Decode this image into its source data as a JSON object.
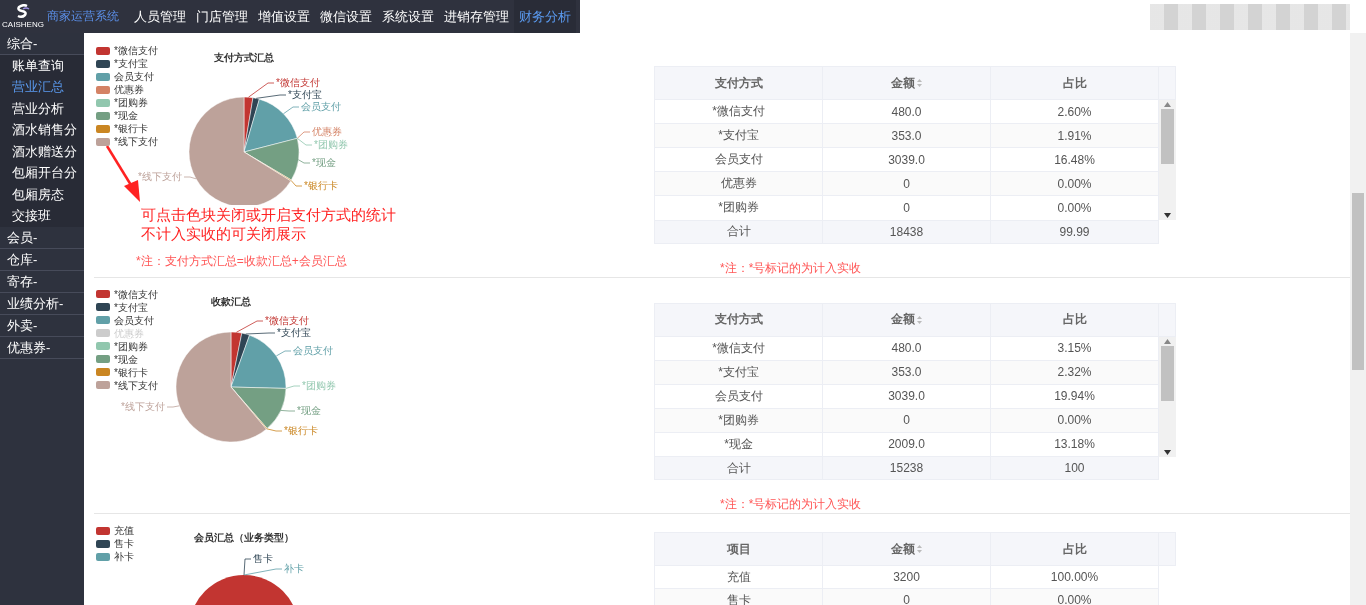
{
  "topbar": {
    "logo_text": "CAISHENG",
    "app_name": "商家运营系统",
    "nav": [
      {
        "label": "人员管理",
        "selected": false
      },
      {
        "label": "门店管理",
        "selected": false
      },
      {
        "label": "增值设置",
        "selected": false
      },
      {
        "label": "微信设置",
        "selected": false
      },
      {
        "label": "系统设置",
        "selected": false
      },
      {
        "label": "进销存管理",
        "selected": false
      },
      {
        "label": "财务分析",
        "selected": true
      }
    ]
  },
  "sidebar": {
    "groups": [
      {
        "label": "综合-",
        "children": [
          {
            "label": "账单查询",
            "selected": false
          },
          {
            "label": "营业汇总",
            "selected": true
          },
          {
            "label": "营业分析",
            "selected": false
          },
          {
            "label": "酒水销售分",
            "selected": false
          },
          {
            "label": "酒水赠送分",
            "selected": false
          },
          {
            "label": "包厢开台分",
            "selected": false
          },
          {
            "label": "包厢房态",
            "selected": false
          },
          {
            "label": "交接班",
            "selected": false
          }
        ]
      },
      {
        "label": "会员-"
      },
      {
        "label": "仓库-"
      },
      {
        "label": "寄存-"
      },
      {
        "label": "业绩分析-"
      },
      {
        "label": "外卖-"
      },
      {
        "label": "优惠券-"
      }
    ]
  },
  "sections": [
    {
      "chart": {
        "title": "支付方式汇总",
        "legend": [
          {
            "label": "*微信支付",
            "color": "#c23531",
            "disabled": false,
            "slice_label": "*微信支付"
          },
          {
            "label": "*支付宝",
            "color": "#2f4554",
            "disabled": false,
            "slice_label": "*支付宝"
          },
          {
            "label": "会员支付",
            "color": "#61a0a8",
            "disabled": false,
            "slice_label": "会员支付"
          },
          {
            "label": "优惠券",
            "color": "#d48265",
            "disabled": false,
            "slice_label": "优惠券"
          },
          {
            "label": "*团购券",
            "color": "#91c7ae",
            "disabled": false,
            "slice_label": "*团购券"
          },
          {
            "label": "*现金",
            "color": "#749f83",
            "disabled": false,
            "slice_label": "*现金"
          },
          {
            "label": "*银行卡",
            "color": "#ca8622",
            "disabled": false,
            "slice_label": "*银行卡"
          },
          {
            "label": "*线下支付",
            "color": "#bda29a",
            "disabled": false,
            "slice_label": "*线下支付"
          }
        ]
      },
      "annotation": [
        "可点击色块关闭或开启支付方式的统计",
        "不计入实收的可关闭展示"
      ],
      "note_left": "*注：支付方式汇总=收款汇总+会员汇总",
      "table": {
        "scrollable": true,
        "columns": [
          {
            "label": "支付方式",
            "sortable": false
          },
          {
            "label": "金额",
            "sortable": true
          },
          {
            "label": "占比",
            "sortable": false
          }
        ],
        "rows": [
          [
            "*微信支付",
            "480.0",
            "2.60%"
          ],
          [
            "*支付宝",
            "353.0",
            "1.91%"
          ],
          [
            "会员支付",
            "3039.0",
            "16.48%"
          ],
          [
            "优惠券",
            "0",
            "0.00%"
          ],
          [
            "*团购券",
            "0",
            "0.00%"
          ]
        ],
        "total": [
          "合计",
          "18438",
          "99.99"
        ]
      },
      "note_right": "*注：*号标记的为计入实收"
    },
    {
      "chart": {
        "title": "收款汇总",
        "legend": [
          {
            "label": "*微信支付",
            "color": "#c23531",
            "disabled": false,
            "slice_label": "*微信支付"
          },
          {
            "label": "*支付宝",
            "color": "#2f4554",
            "disabled": false,
            "slice_label": "*支付宝"
          },
          {
            "label": "会员支付",
            "color": "#61a0a8",
            "disabled": false,
            "slice_label": "会员支付"
          },
          {
            "label": "优惠券",
            "disabled": true
          },
          {
            "label": "*团购券",
            "color": "#91c7ae",
            "disabled": false,
            "slice_label": "*团购券"
          },
          {
            "label": "*现金",
            "color": "#749f83",
            "disabled": false,
            "slice_label": "*现金"
          },
          {
            "label": "*银行卡",
            "color": "#ca8622",
            "disabled": false,
            "slice_label": "*银行卡"
          },
          {
            "label": "*线下支付",
            "color": "#bda29a",
            "disabled": false,
            "slice_label": "*线下支付"
          }
        ]
      },
      "table": {
        "scrollable": true,
        "columns": [
          {
            "label": "支付方式",
            "sortable": false
          },
          {
            "label": "金额",
            "sortable": true
          },
          {
            "label": "占比",
            "sortable": false
          }
        ],
        "rows": [
          [
            "*微信支付",
            "480.0",
            "3.15%"
          ],
          [
            "*支付宝",
            "353.0",
            "2.32%"
          ],
          [
            "会员支付",
            "3039.0",
            "19.94%"
          ],
          [
            "*团购券",
            "0",
            "0.00%"
          ],
          [
            "*现金",
            "2009.0",
            "13.18%"
          ]
        ],
        "total": [
          "合计",
          "15238",
          "100"
        ]
      },
      "note_right": "*注：*号标记的为计入实收"
    },
    {
      "chart": {
        "title": "会员汇总（业务类型）",
        "legend": [
          {
            "label": "充值",
            "color": "#c23531",
            "disabled": false
          },
          {
            "label": "售卡",
            "color": "#2f4554",
            "disabled": false,
            "slice_label": "售卡"
          },
          {
            "label": "补卡",
            "color": "#61a0a8",
            "disabled": false,
            "slice_label": "补卡"
          }
        ]
      },
      "table": {
        "scrollable": false,
        "columns": [
          {
            "label": "项目",
            "sortable": false
          },
          {
            "label": "金额",
            "sortable": true
          },
          {
            "label": "占比",
            "sortable": false
          }
        ],
        "rows": [
          [
            "充值",
            "3200",
            "100.00%"
          ],
          [
            "售卡",
            "0",
            "0.00%"
          ]
        ]
      }
    }
  ]
}
